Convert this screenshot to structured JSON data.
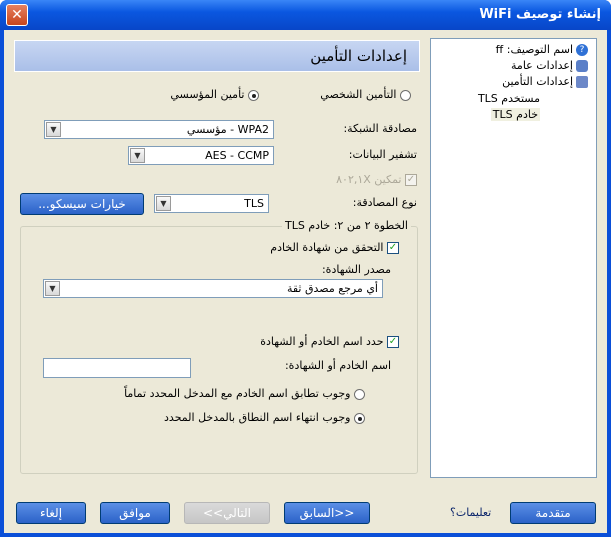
{
  "window": {
    "title": "إنشاء توصيف WiFi"
  },
  "nav": {
    "items": [
      {
        "label": "اسم التوصيف: ff",
        "icon": "info-icon"
      },
      {
        "label": "إعدادات عامة",
        "icon": "users-icon"
      },
      {
        "label": "إعدادات التأمين",
        "icon": "lock-icon"
      },
      {
        "label": "مستخدم TLS",
        "icon": ""
      },
      {
        "label": "خادم TLS",
        "icon": ""
      }
    ]
  },
  "header": {
    "title": "إعدادات التأمين"
  },
  "security": {
    "enterprise_label": "تأمين المؤسسي",
    "personal_label": "التأمين الشخصي",
    "network_auth_label": "مصادقة الشبكة:",
    "network_auth_value": "WPA2 - مؤسسي",
    "data_encryption_label": "تشفير البيانات:",
    "data_encryption_value": "AES - CCMP",
    "enable_8021x_label": "تمكين ٨٠٢,١X",
    "auth_type_label": "نوع المصادقة:",
    "auth_type_value": "TLS",
    "cisco_options_button": "خيارات سيسكو..."
  },
  "step": {
    "title": "الخطوة ٢ من ٢: خادم TLS",
    "verify_cert_label": "التحقق من شهادة الخادم",
    "cert_source_label": "مصدر الشهادة:",
    "cert_source_value": "أي مرجع مصدق ثقة",
    "specify_server_label": "حدد اسم الخادم أو الشهادة",
    "server_name_label": "اسم الخادم أو الشهادة:",
    "server_name_value": "",
    "exact_match_label": "وجوب تطابق اسم الخادم مع المدخل المحدد تماماً",
    "domain_end_label": "وجوب انتهاء اسم النطاق بالمدخل المحدد"
  },
  "footer": {
    "advanced_button": "متقدمة",
    "help_link": "تعليمات؟",
    "back_button": "<<السابق",
    "next_button": "التالي>>",
    "ok_button": "موافق",
    "cancel_button": "إلغاء"
  }
}
